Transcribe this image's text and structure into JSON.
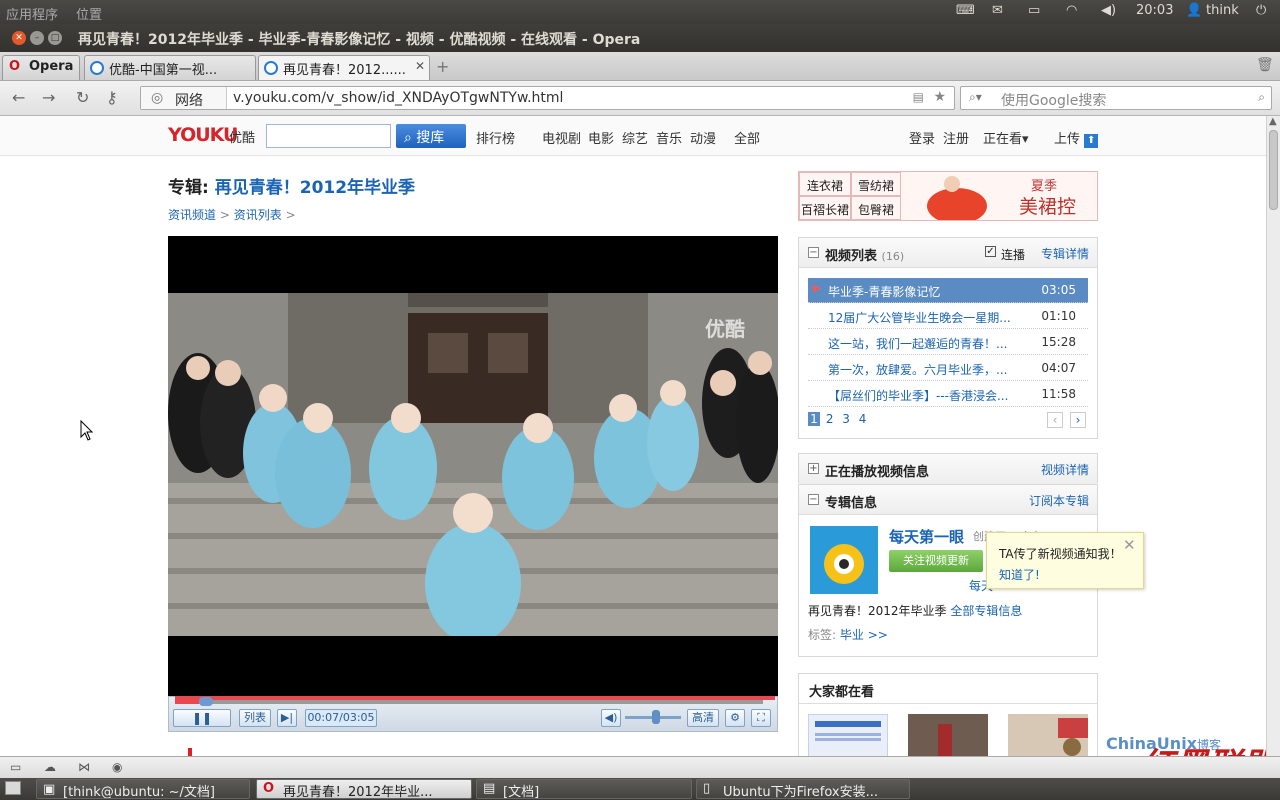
{
  "system_panel": {
    "menus": [
      "应用程序",
      "位置"
    ],
    "clock": "20:03",
    "user": "think"
  },
  "window": {
    "title": "再见青春！2012年毕业季 - 毕业季-青春影像记忆 - 视频 - 优酷视频 - 在线观看 - Opera"
  },
  "tabs": {
    "opera_menu": "Opera",
    "items": [
      {
        "label": "优酷-中国第一视..."
      },
      {
        "label": "再见青春！2012......"
      }
    ]
  },
  "address_bar": {
    "site_label": "网络",
    "url": "v.youku.com/v_show/id_XNDAyOTgwNTYw.html",
    "search_placeholder": "使用Google搜索"
  },
  "youku_header": {
    "logo": "YOUKU",
    "logo_cn": "优酷",
    "search_button": "搜库",
    "nav": [
      "排行榜",
      "电视剧",
      "电影",
      "综艺",
      "音乐",
      "动漫",
      "全部"
    ],
    "login": "登录",
    "register": "注册",
    "watching": "正在看",
    "upload": "上传"
  },
  "album": {
    "label": "专辑:",
    "name": "再见青春！2012年毕业季",
    "breadcrumb": [
      "资讯频道",
      "资讯列表"
    ]
  },
  "player": {
    "watermark": "优酷",
    "list_button": "列表",
    "time": "00:07/03:05",
    "progress": 0.04,
    "quality": "高清",
    "volume": 0.55
  },
  "ad": {
    "cells": [
      "连衣裙",
      "雪纺裙",
      "百褶长裙",
      "包臀裙"
    ],
    "tag": "夏季",
    "slogan": "美裙控"
  },
  "video_list": {
    "title": "视频列表",
    "count": "(16)",
    "autoplay_label": "连播",
    "detail_link": "专辑详情",
    "items": [
      {
        "title": "毕业季-青春影像记忆",
        "duration": "03:05",
        "active": true
      },
      {
        "title": "12届广大公管毕业生晚会一星期...",
        "duration": "01:10"
      },
      {
        "title": "这一站，我们一起邂逅的青春！...",
        "duration": "15:28"
      },
      {
        "title": "第一次，放肆爱。六月毕业季，...",
        "duration": "04:07"
      },
      {
        "title": "【屌丝们的毕业季】---香港浸会...",
        "duration": "11:58"
      }
    ],
    "pages": [
      "1",
      "2",
      "3",
      "4"
    ]
  },
  "now_playing": {
    "title": "正在播放视频信息",
    "link": "视频详情"
  },
  "album_info": {
    "title": "专辑信息",
    "subscribe": "订阅本专辑",
    "channel_name": "每天第一眼",
    "channel_extra": "创建了20个专...",
    "follow_button": "关注视频更新",
    "channel_more": "每天",
    "album_line": "再见青春！2012年毕业季",
    "all_info": "全部专辑信息",
    "tags_label": "标签:",
    "tag": "毕业 >>"
  },
  "tooltip": {
    "line1": "TA传了新视频通知我！",
    "line2": "知道了!"
  },
  "popular": {
    "title": "大家都在看"
  },
  "watermark_site": {
    "name": "ChinaUnix",
    "blog": "博客",
    "sub": "blog",
    "brand": "红黑联盟"
  },
  "taskbar": {
    "items": [
      {
        "label": "[think@ubuntu: ~/文档]"
      },
      {
        "label": "再见青春！2012年毕业..."
      },
      {
        "label": "[文档]"
      },
      {
        "label": "Ubuntu下为Firefox安装..."
      }
    ]
  }
}
